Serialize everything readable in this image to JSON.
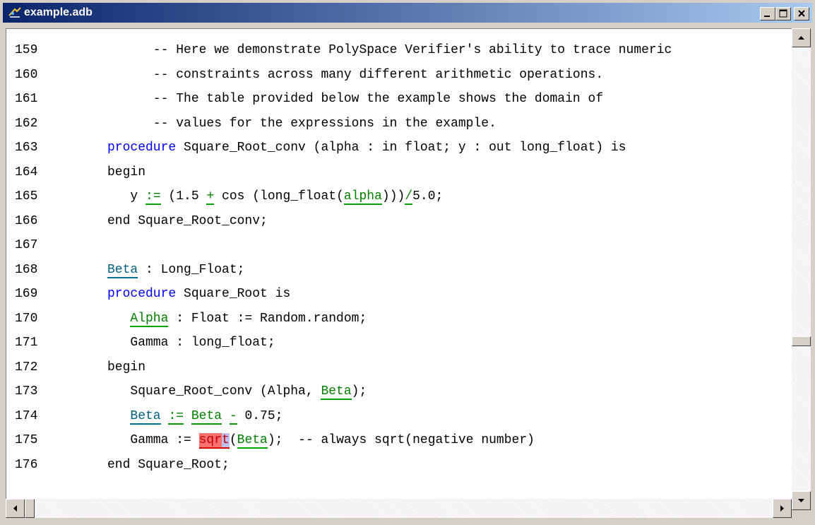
{
  "window": {
    "title": "example.adb"
  },
  "lines": [
    {
      "num": "159",
      "tokens": [
        [
          "",
          "      -- Here we demonstrate PolySpace Verifier's ability to trace numeric"
        ]
      ]
    },
    {
      "num": "160",
      "tokens": [
        [
          "",
          "      -- constraints across many different arithmetic operations."
        ]
      ]
    },
    {
      "num": "161",
      "tokens": [
        [
          "",
          "      -- The table provided below the example shows the domain of"
        ]
      ]
    },
    {
      "num": "162",
      "tokens": [
        [
          "",
          "      -- values for the expressions in the example."
        ]
      ]
    },
    {
      "num": "163",
      "tokens": [
        [
          "kw",
          "procedure"
        ],
        [
          "",
          " Square_Root_conv (alpha : in float; y : out long_float) is"
        ]
      ]
    },
    {
      "num": "164",
      "tokens": [
        [
          "",
          "begin"
        ]
      ]
    },
    {
      "num": "165",
      "tokens": [
        [
          "",
          "   y "
        ],
        [
          "g",
          ":="
        ],
        [
          "",
          " (1.5 "
        ],
        [
          "g",
          "+"
        ],
        [
          "",
          " cos (long_float("
        ],
        [
          "g",
          "alpha"
        ],
        [
          "",
          ")))"
        ],
        [
          "g",
          "/"
        ],
        [
          "",
          "5.0;"
        ]
      ]
    },
    {
      "num": "166",
      "tokens": [
        [
          "",
          "end Square_Root_conv;"
        ]
      ]
    },
    {
      "num": "167",
      "tokens": []
    },
    {
      "num": "168",
      "tokens": [
        [
          "t",
          "Beta"
        ],
        [
          "",
          " : Long_Float;"
        ]
      ]
    },
    {
      "num": "169",
      "tokens": [
        [
          "kw",
          "procedure"
        ],
        [
          "",
          " Square_Root is"
        ]
      ]
    },
    {
      "num": "170",
      "tokens": [
        [
          "",
          "   "
        ],
        [
          "g",
          "Alpha"
        ],
        [
          "",
          " : Float := Random.random;"
        ]
      ]
    },
    {
      "num": "171",
      "tokens": [
        [
          "",
          "   Gamma : long_float;"
        ]
      ]
    },
    {
      "num": "172",
      "tokens": [
        [
          "",
          "begin"
        ]
      ]
    },
    {
      "num": "173",
      "tokens": [
        [
          "",
          "   Square_Root_conv (Alpha, "
        ],
        [
          "g",
          "Beta"
        ],
        [
          "",
          ");"
        ]
      ]
    },
    {
      "num": "174",
      "tokens": [
        [
          "",
          "   "
        ],
        [
          "t",
          "Beta"
        ],
        [
          "",
          " "
        ],
        [
          "g",
          ":="
        ],
        [
          "",
          " "
        ],
        [
          "g",
          "Beta"
        ],
        [
          "",
          " "
        ],
        [
          "g",
          "-"
        ],
        [
          "",
          " 0.75;"
        ]
      ]
    },
    {
      "num": "175",
      "tokens": [
        [
          "",
          "   Gamma := "
        ],
        [
          "r",
          "sqr"
        ],
        [
          "rsel",
          "t"
        ],
        [
          "",
          "("
        ],
        [
          "g",
          "Beta"
        ],
        [
          "",
          ");  -- always sqrt(negative number)"
        ]
      ]
    },
    {
      "num": "176",
      "tokens": [
        [
          "",
          "end Square_Root;"
        ]
      ]
    }
  ],
  "icons": {
    "app": "ada-file-icon",
    "minimize": "minimize-icon",
    "maximize": "maximize-icon",
    "close": "close-icon",
    "scroll_up": "arrow-up-icon",
    "scroll_down": "arrow-down-icon",
    "scroll_left": "arrow-left-icon",
    "scroll_right": "arrow-right-icon"
  },
  "colors": {
    "title_bar_start": "#0a246a",
    "title_bar_end": "#a6caf0",
    "keyword": "#0000ff",
    "green_check": "#008000",
    "orange_check": "#006080",
    "red_check": "#ff7070"
  }
}
